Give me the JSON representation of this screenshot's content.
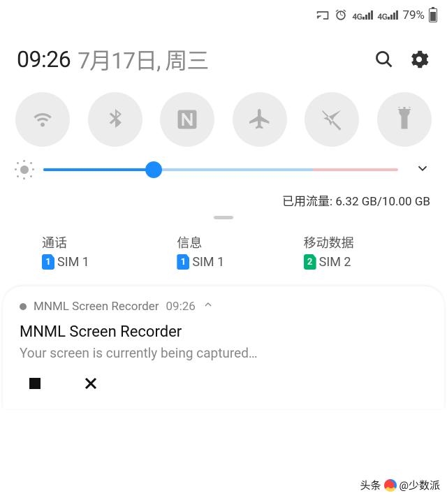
{
  "status_bar": {
    "network_label_1": "4G",
    "network_label_2": "4G",
    "battery_pct": "79%"
  },
  "header": {
    "time": "09:26",
    "date": "7月17日, 周三"
  },
  "toggles": {
    "wifi": "wifi-icon",
    "bluetooth": "bluetooth-icon",
    "nfc": "nfc-icon",
    "airplane": "airplane-icon",
    "location": "location-off-icon",
    "flashlight": "flashlight-icon"
  },
  "brightness": {
    "value_pct": 31
  },
  "data_usage": "已用流量: 6.32 GB/10.00 GB",
  "sim_cards": {
    "calls": {
      "label": "通话",
      "name": "SIM 1",
      "slot": "1",
      "color": "blue"
    },
    "messages": {
      "label": "信息",
      "name": "SIM 1",
      "slot": "1",
      "color": "blue"
    },
    "data": {
      "label": "移动数据",
      "name": "SIM 2",
      "slot": "2",
      "color": "green"
    }
  },
  "notification": {
    "app_name": "MNML Screen Recorder",
    "time": "09:26",
    "title": "MNML Screen Recorder",
    "body": "Your screen is currently being captured…"
  },
  "watermark": {
    "prefix": "头条",
    "handle": "@少数派"
  }
}
